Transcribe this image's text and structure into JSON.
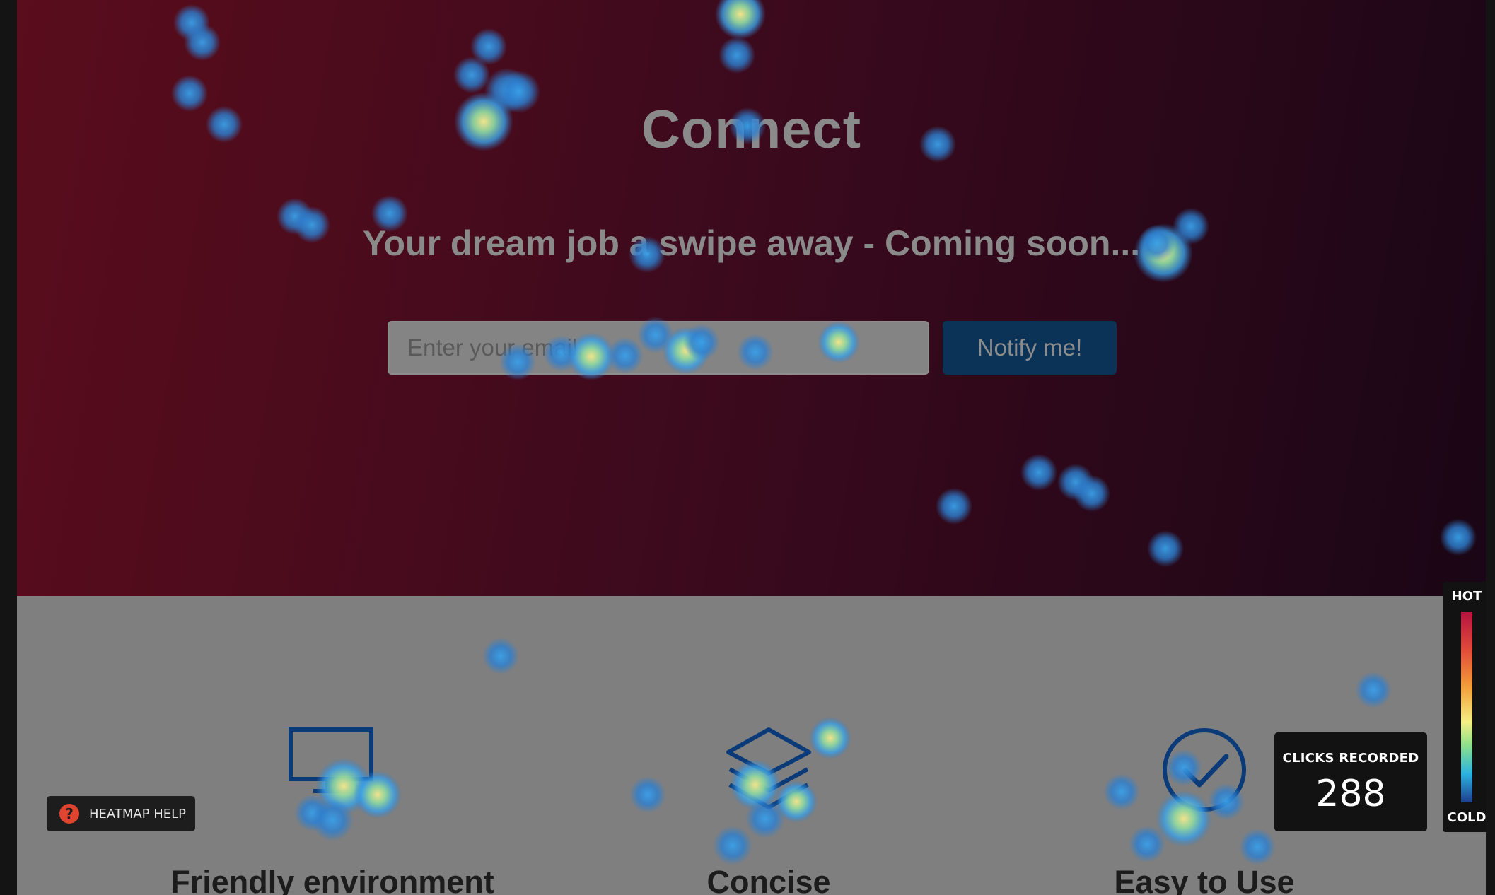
{
  "hero": {
    "title": "Connect",
    "subtitle": "Your dream job a swipe away - Coming soon...",
    "email_placeholder": "Enter your email...",
    "notify_label": "Notify me!"
  },
  "features": [
    {
      "icon": "monitor-icon",
      "label": "Friendly environment"
    },
    {
      "icon": "layers-icon",
      "label": "Concise"
    },
    {
      "icon": "check-circle-icon",
      "label": "Easy to Use"
    }
  ],
  "heatmap": {
    "help_label": "HEATMAP HELP",
    "clicks_title": "CLICKS RECORDED",
    "clicks_count": "288",
    "legend_hot": "HOT",
    "legend_cold": "COLD"
  },
  "colors": {
    "accent_button": "#0b3358",
    "help_icon": "#e0442e",
    "feature_icon": "#0a3a78"
  }
}
